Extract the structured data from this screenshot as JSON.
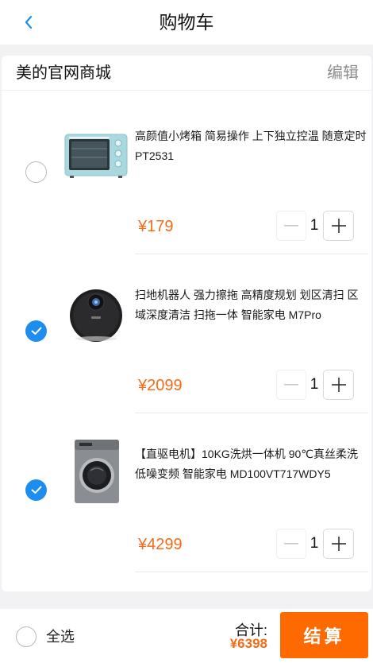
{
  "header": {
    "title": "购物车",
    "back_icon": "chevron-left-icon"
  },
  "shop": {
    "name": "美的官网商城",
    "edit_label": "编辑"
  },
  "colors": {
    "accent": "#1d8ef0",
    "price": "#f56b18",
    "checkout": "#ff6a00"
  },
  "items": [
    {
      "name": "高颜值小烤箱 简易操作 上下独立控温 随意定时 PT2531",
      "price": "¥179",
      "quantity": "1",
      "checked": false,
      "image_icon": "oven-image"
    },
    {
      "name": "扫地机器人 强力擦拖 高精度规划 划区清扫 区域深度清洁 扫拖一体 智能家电 M7Pro",
      "price": "¥2099",
      "quantity": "1",
      "checked": true,
      "image_icon": "robot-vacuum-image"
    },
    {
      "name": "【直驱电机】10KG洗烘一体机 90℃真丝柔洗 低噪变频 智能家电 MD100VT717WDY5",
      "price": "¥4299",
      "quantity": "1",
      "checked": true,
      "image_icon": "washing-machine-image"
    }
  ],
  "footer": {
    "select_all_label": "全选",
    "total_label": "合计:",
    "total_value": "¥6398",
    "checkout_label": "结算"
  }
}
